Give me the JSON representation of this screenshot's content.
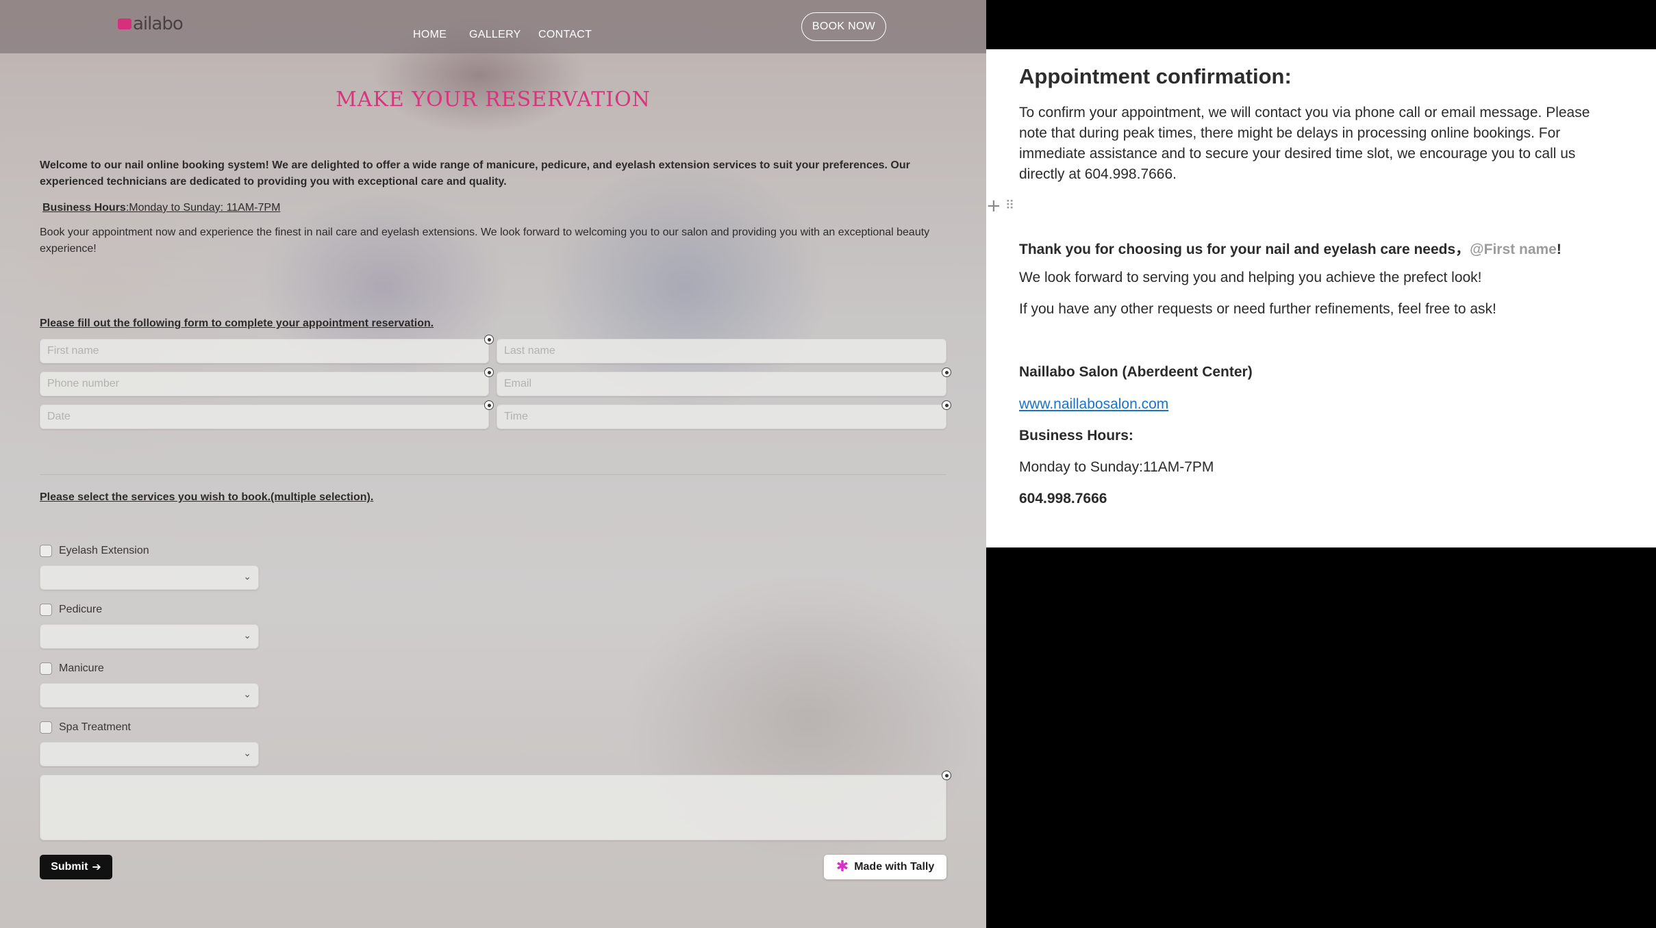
{
  "header": {
    "logo_text": "ailabo",
    "nav": [
      "HOME",
      "GALLERY",
      "CONTACT"
    ],
    "book_now": "BOOK NOW"
  },
  "page_title": "MAKE YOUR RESERVATION",
  "intro": "Welcome to our nail online booking system! We are delighted to offer a wide range of manicure, pedicure, and eyelash extension services to suit your preferences. Our experienced technicians are dedicated to providing you with exceptional care and quality.",
  "hours": {
    "label": "Business Hours",
    "value": ":Monday to Sunday: 11AM-7PM"
  },
  "book_text": "Book your appointment now and experience the finest in nail care and eyelash extensions. We look forward to welcoming you to our salon and providing you with an exceptional beauty experience!",
  "form": {
    "heading": "Please fill out the following form to complete your appointment reservation.",
    "first_name": "First name",
    "last_name": "Last name",
    "phone": "Phone number",
    "email": "Email",
    "date": "Date",
    "time": "Time"
  },
  "services": {
    "heading": "Please select the services you wish to book.(multiple selection).",
    "items": [
      "Eyelash Extension",
      "Pedicure",
      "Manicure",
      "Spa Treatment"
    ]
  },
  "submit_label": "Submit",
  "tally_label": "Made with Tally",
  "confirmation": {
    "title": "Appointment confirmation:",
    "body": "To confirm your appointment, we will contact  you via phone call or email message. Please note that during peak times, there might be delays in processing online bookings. For immediate assistance and to secure your desired time slot, we encourage you to call us directly at 604.998.7666.",
    "thanks_prefix": "Thank you for choosing us for your nail and eyelash care needs，",
    "mention": "@First name",
    "thanks_suffix": "!",
    "look_forward": "We look forward to serving you and helping you achieve the prefect look!",
    "other_requests": "If you have any other requests or need further refinements, feel free to ask!",
    "salon": "Naillabo Salon (Aberdeent Center)",
    "website": "www.naillabosalon.com",
    "bh_label": "Business Hours:",
    "bh_value": "Monday to Sunday:11AM-7PM",
    "phone": "604.998.7666"
  }
}
